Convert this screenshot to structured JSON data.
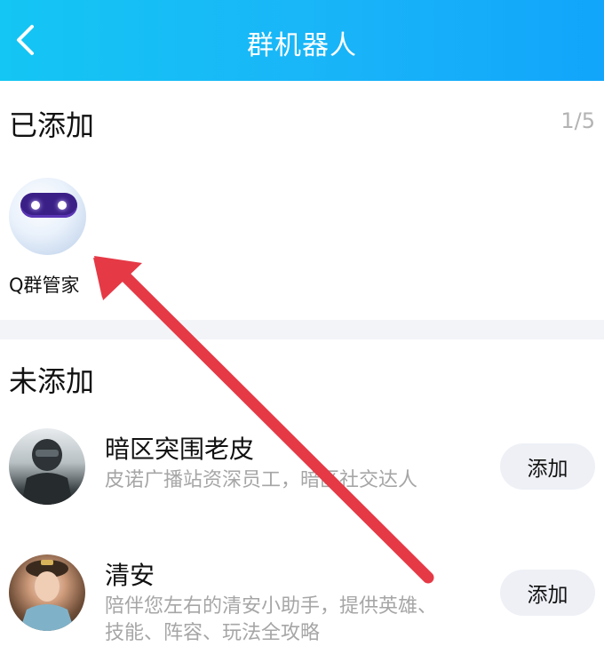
{
  "header": {
    "title": "群机器人",
    "back_icon": "chevron-left-icon",
    "gradient": [
      "#14c6f3",
      "#12a5fb"
    ]
  },
  "added": {
    "title": "已添加",
    "count": "1/5",
    "bots": [
      {
        "name": "Q群管家",
        "avatar": "robot-avatar"
      }
    ]
  },
  "not_added": {
    "title": "未添加",
    "bots": [
      {
        "name": "暗区突围老皮",
        "desc_lines": [
          "皮诺广播站资深员工，暗区社交达人"
        ],
        "button": "添加",
        "avatar": "soldier-avatar"
      },
      {
        "name": "清安",
        "desc_lines": [
          "陪伴您左右的清安小助手，提供英雄、",
          "技能、阵容、玩法全攻略"
        ],
        "button": "添加",
        "avatar": "lady-avatar"
      }
    ]
  },
  "annotation": {
    "arrow_color": "#e53946",
    "arrow_icon": "red-arrow-annotation"
  }
}
